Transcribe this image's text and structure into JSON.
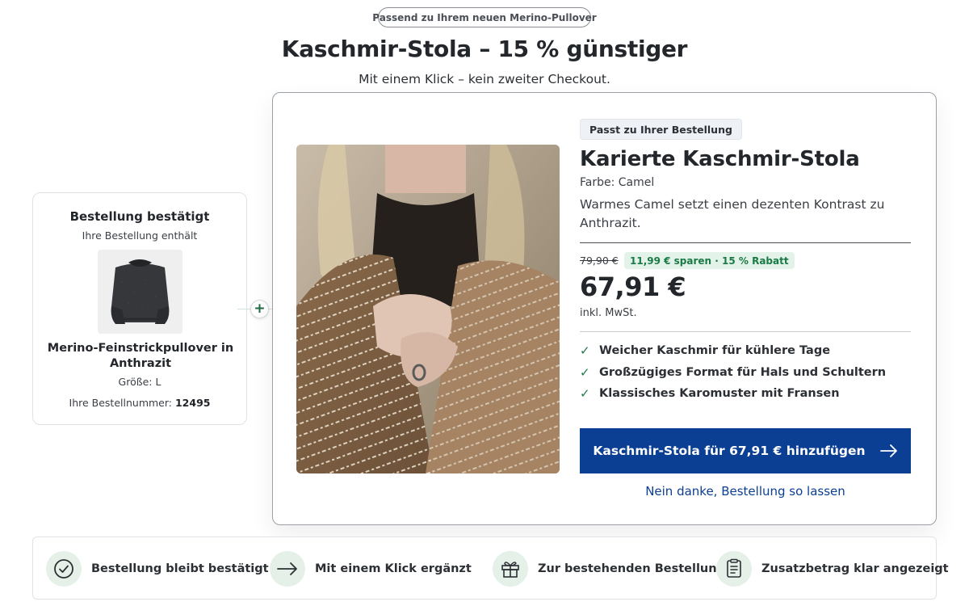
{
  "header": {
    "badge": "Passend zu Ihrem neuen Merino-Pullover",
    "title": "Kaschmir-Stola – 15 % günstiger",
    "subtitle": "Mit einem Klick – kein zweiter Checkout."
  },
  "order": {
    "title": "Bestellung bestätigt",
    "subtitle": "Ihre Bestellung enthält",
    "product_name": "Merino-Feinstrickpullover in Anthrazit",
    "size": "Größe: L",
    "number_label": "Ihre Bestellnummer:",
    "number": "12495"
  },
  "offer": {
    "badge": "Passt zu Ihrer Bestellung",
    "title": "Karierte Kaschmir-Stola",
    "color": "Farbe: Camel",
    "description": "Warmes Camel setzt einen dezenten Kontrast zu Anthrazit.",
    "old_price": "79,90 €",
    "savings": "11,99 € sparen · 15 % Rabatt",
    "price": "67,91 €",
    "vat": "inkl. MwSt.",
    "features": [
      "Weicher Kaschmir für kühlere Tage",
      "Großzügiges Format für Hals und Schultern",
      "Klassisches Karomuster mit Fransen"
    ],
    "cta_label": "Kaschmir-Stola für 67,91 € hinzufügen",
    "decline_label": "Nein danke, Bestellung so lassen"
  },
  "trust": [
    {
      "label": "Bestellung bleibt bestätigt",
      "icon": "check-circle-icon"
    },
    {
      "label": "Mit einem Klick ergänzt",
      "icon": "arrow-right-icon"
    },
    {
      "label": "Zur bestehenden Bestellung",
      "icon": "gift-icon"
    },
    {
      "label": "Zusatzbetrag klar angezeigt",
      "icon": "receipt-icon"
    }
  ],
  "colors": {
    "primary": "#0b3f93",
    "success": "#1f7a4a",
    "success_bg": "#e3f3e9",
    "trust_icon_bg": "#e4f0e8"
  }
}
